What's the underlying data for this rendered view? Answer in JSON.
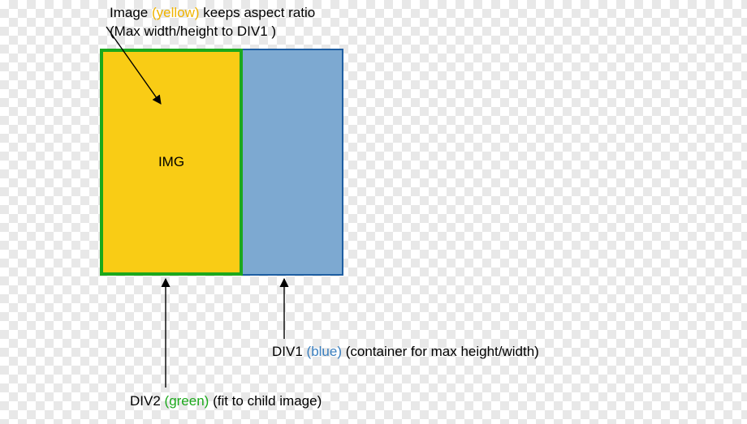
{
  "top_label": {
    "line1_a": "Image ",
    "line1_yellow": "(yellow)",
    "line1_b": " keeps aspect ratio",
    "line2": "(Max width/height to DIV1 )"
  },
  "img_label": "IMG",
  "div1_label": {
    "a": "DIV1 ",
    "blue": "(blue)",
    "b": " (container for max height/width)"
  },
  "div2_label": {
    "a": "DIV2 ",
    "green": "(green)",
    "b": " (fit to child image)"
  },
  "colors": {
    "yellow": "#f9cc15",
    "green": "#1ca81c",
    "blue": "#7da9d1",
    "blue_border": "#1e5ea2"
  }
}
